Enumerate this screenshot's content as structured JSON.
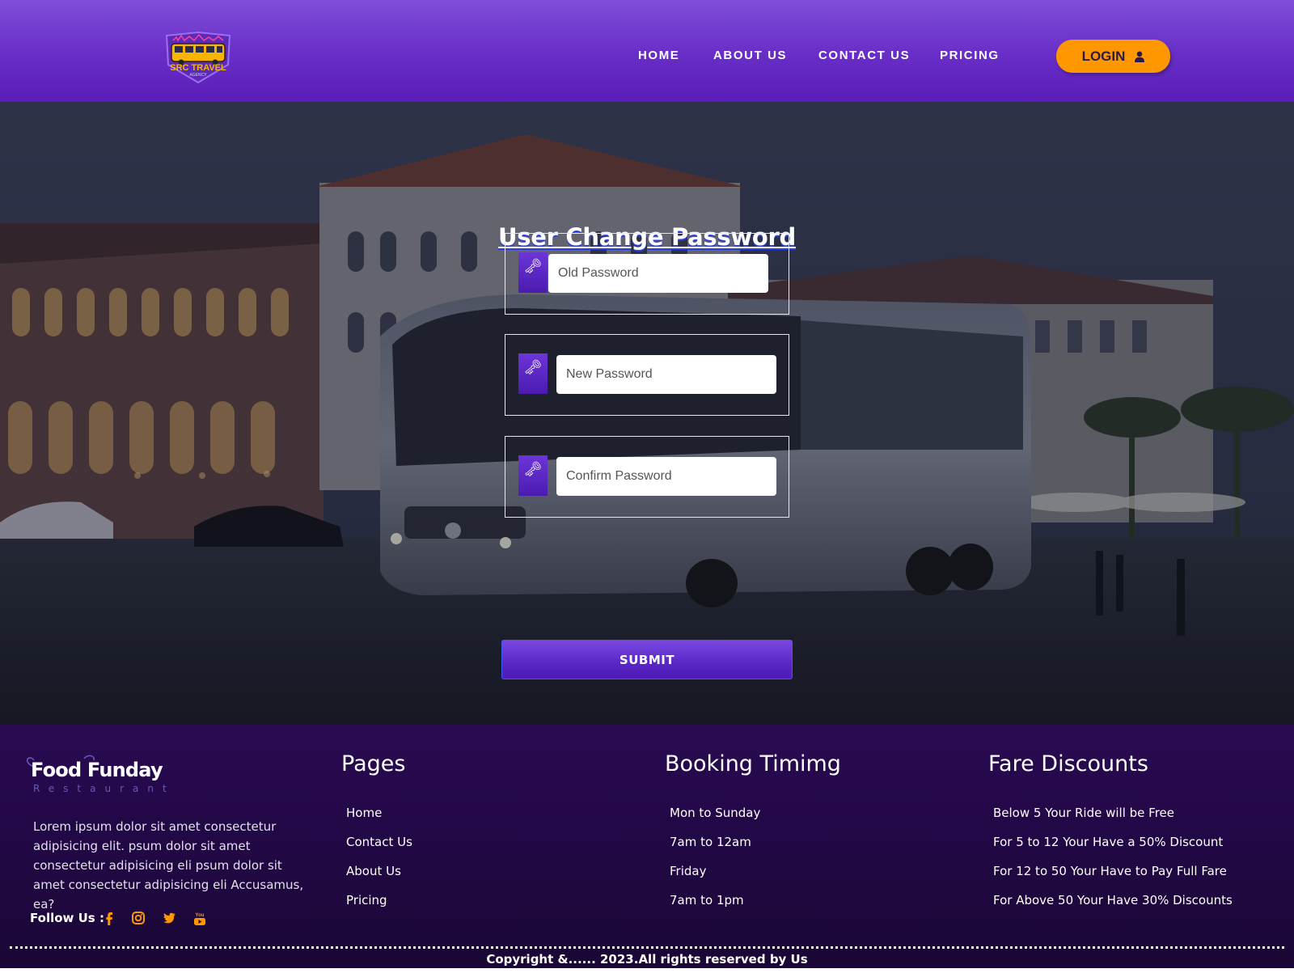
{
  "header": {
    "logo": {
      "text_line1": "SRC TRAVEL",
      "text_line2": "AGENCY"
    },
    "nav": [
      {
        "label": "HOME"
      },
      {
        "label": "ABOUT US"
      },
      {
        "label": "CONTACT US"
      },
      {
        "label": "PRICING"
      }
    ],
    "login_label": "LOGIN",
    "login_icon": "user-icon"
  },
  "main": {
    "title": "User Change Password",
    "fields": [
      {
        "icon": "key-icon",
        "placeholder": "Old Password"
      },
      {
        "icon": "key-icon",
        "placeholder": "New Password"
      },
      {
        "icon": "key-icon",
        "placeholder": "Confirm Password"
      }
    ],
    "submit_label": "SUBMIT",
    "background": "night-city-bus-photo"
  },
  "footer": {
    "brand": {
      "name": "Food Funday",
      "sub": "Restaurant"
    },
    "about": "Lorem ipsum dolor sit amet consectetur adipisicing elit. psum dolor sit amet consectetur adipisicing eli psum dolor sit amet consectetur adipisicing eli Accusamus, ea?",
    "follow_label": "Follow Us :",
    "socials": [
      "facebook-icon",
      "instagram-icon",
      "twitter-icon",
      "youtube-icon"
    ],
    "pages": {
      "title": "Pages",
      "items": [
        "Home",
        "Contact Us",
        "About Us",
        "Pricing"
      ]
    },
    "booking": {
      "title": "Booking Timimg",
      "items": [
        "Mon to Sunday",
        "7am to 12am",
        "Friday",
        "7am to 1pm"
      ]
    },
    "fares": {
      "title": "Fare Discounts",
      "items": [
        "Below 5 Your Ride will be Free",
        "For 5 to 12 Your Have a 50% Discount",
        "For 12 to 50 Your Have to Pay Full Fare",
        "For Above 50 Your Have 30% Discounts"
      ]
    },
    "copyright": "Copyright &...... 2023.All rights reserved by Us"
  },
  "colors": {
    "header_purple": "#6a2fc9",
    "login_orange": "#ff9800",
    "footer_purple": "#220846",
    "social_orange": "#ff9800"
  }
}
